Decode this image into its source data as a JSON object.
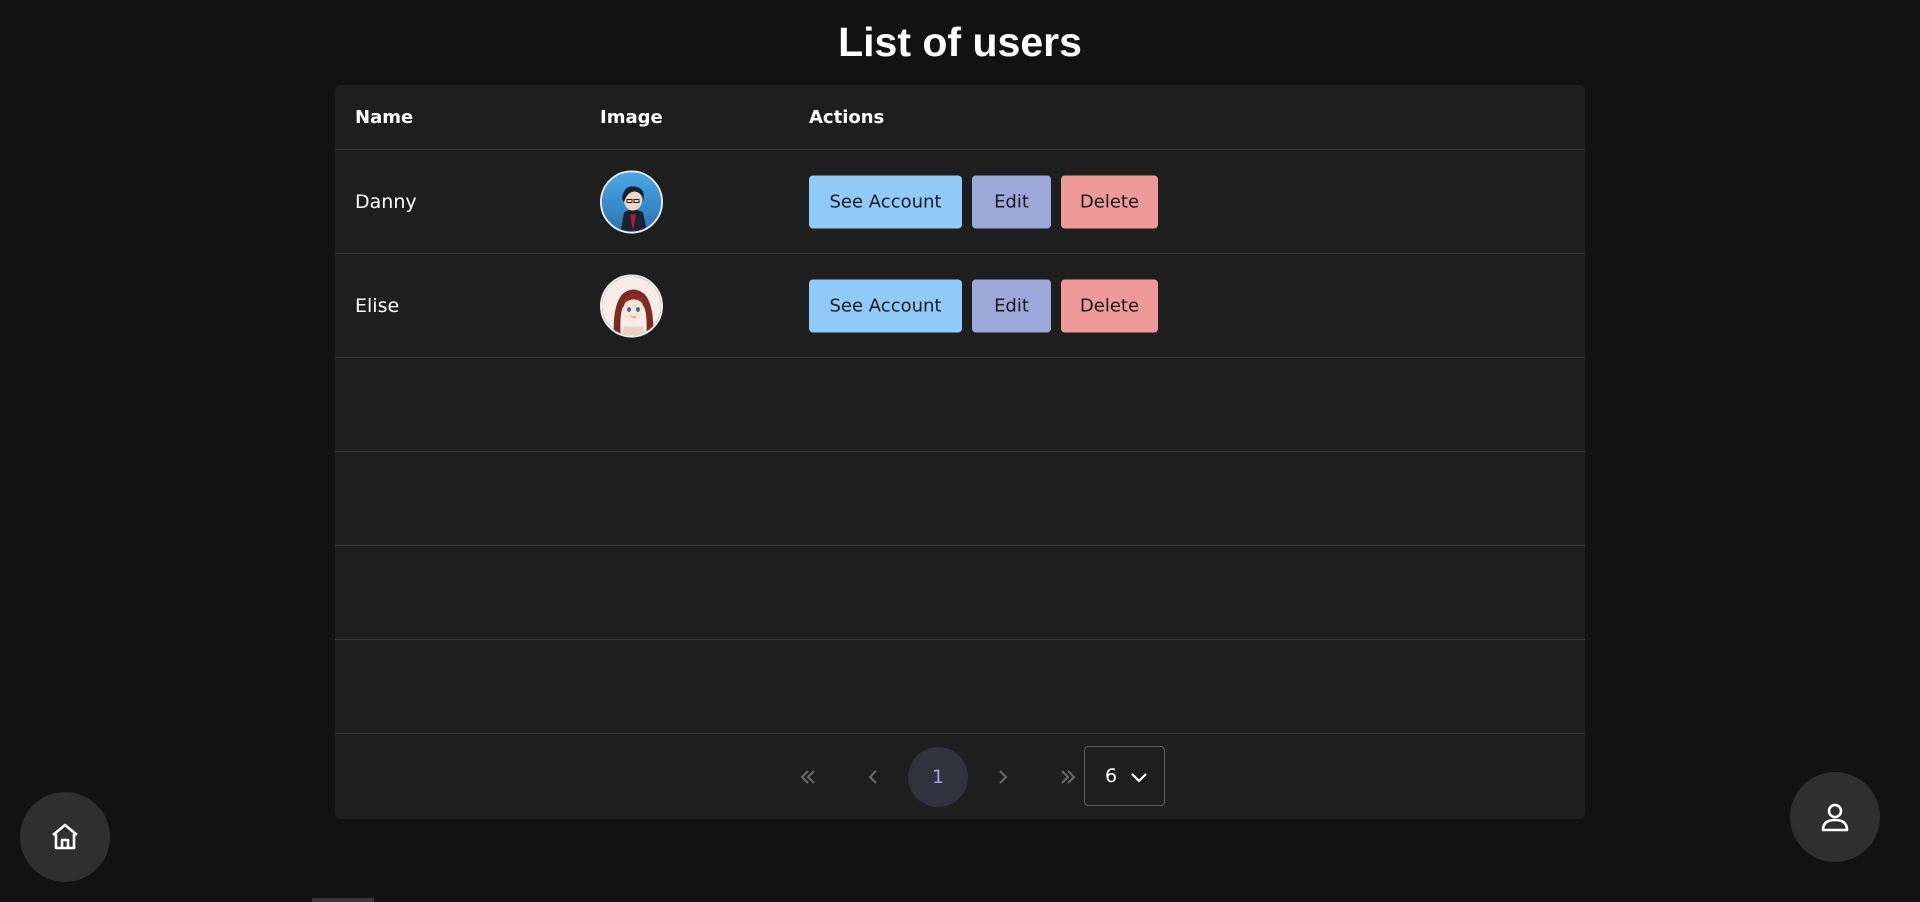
{
  "page": {
    "title": "List of users"
  },
  "table": {
    "columns": [
      "Name",
      "Image",
      "Actions"
    ],
    "rows": [
      {
        "name": "Danny",
        "avatar_icon": "avatar-danny-icon"
      },
      {
        "name": "Elise",
        "avatar_icon": "avatar-elise-icon"
      }
    ],
    "actions": {
      "see_account": "See Account",
      "edit": "Edit",
      "delete": "Delete"
    }
  },
  "pagination": {
    "current_page": "1",
    "page_size": "6"
  },
  "colors": {
    "background": "#121212",
    "card": "#1e1e1e",
    "see_account": "#90caf9",
    "edit": "#9fa8da",
    "delete": "#ef9a9a"
  },
  "fab": {
    "home_icon": "home-icon",
    "user_icon": "user-icon"
  }
}
